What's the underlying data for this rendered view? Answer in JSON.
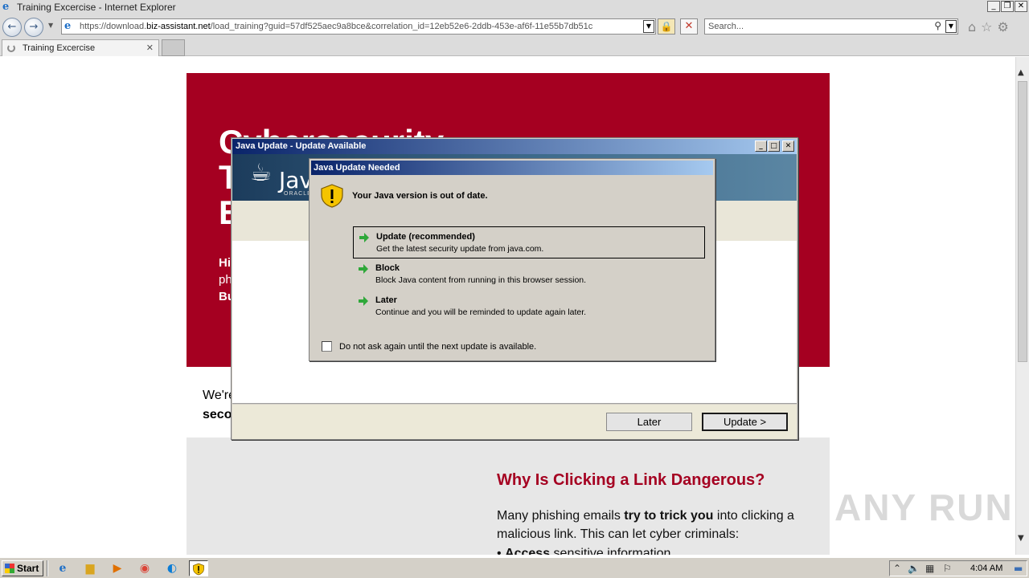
{
  "browser": {
    "window_title": "Training Excercise - Internet Explorer",
    "url_prefix": "https://download.",
    "url_domain": "biz-assistant.net",
    "url_path": "/load_training?guid=57df525aec9a8bce&correlation_id=12eb52e6-2ddb-453e-af6f-11e55b7db51c",
    "search_placeholder": "Search...",
    "tab_label": "Training Excercise"
  },
  "page": {
    "hero_title": "Cybersecurity\nT\nE",
    "hero_para_line1": "Hi",
    "hero_para_line2": "ph",
    "hero_para_line3": "Bu",
    "below_line1": "We're",
    "below_line2": "seco",
    "section_heading": "Why Is Clicking a Link Dangerous?",
    "section_body_pre": "Many phishing emails ",
    "section_body_bold": "try to trick you",
    "section_body_post": " into clicking a malicious link. This can let cyber criminals:",
    "section_bullet_bold": "Access",
    "section_bullet_rest": " sensitive information",
    "watermark": "ANY RUN"
  },
  "java_window": {
    "title": "Java Update - Update Available",
    "logo_text": "Java",
    "logo_sub": "ORACLE",
    "later_button": "Later",
    "update_button": "Update >"
  },
  "dialog": {
    "title": "Java Update Needed",
    "message": "Your Java version is out of date.",
    "options": [
      {
        "title": "Update (recommended)",
        "desc": "Get the latest security update from java.com."
      },
      {
        "title": "Block",
        "desc": "Block Java content from running in this browser session."
      },
      {
        "title": "Later",
        "desc": "Continue and you will be reminded to update again later."
      }
    ],
    "checkbox_label": "Do not ask again until the next update is available."
  },
  "taskbar": {
    "start_label": "Start",
    "clock": "4:04 AM"
  },
  "colors": {
    "brand_red": "#a50021",
    "titlebar_dark": "#0a246a",
    "titlebar_light": "#a6caf0",
    "arrow_green": "#2fa83a"
  }
}
